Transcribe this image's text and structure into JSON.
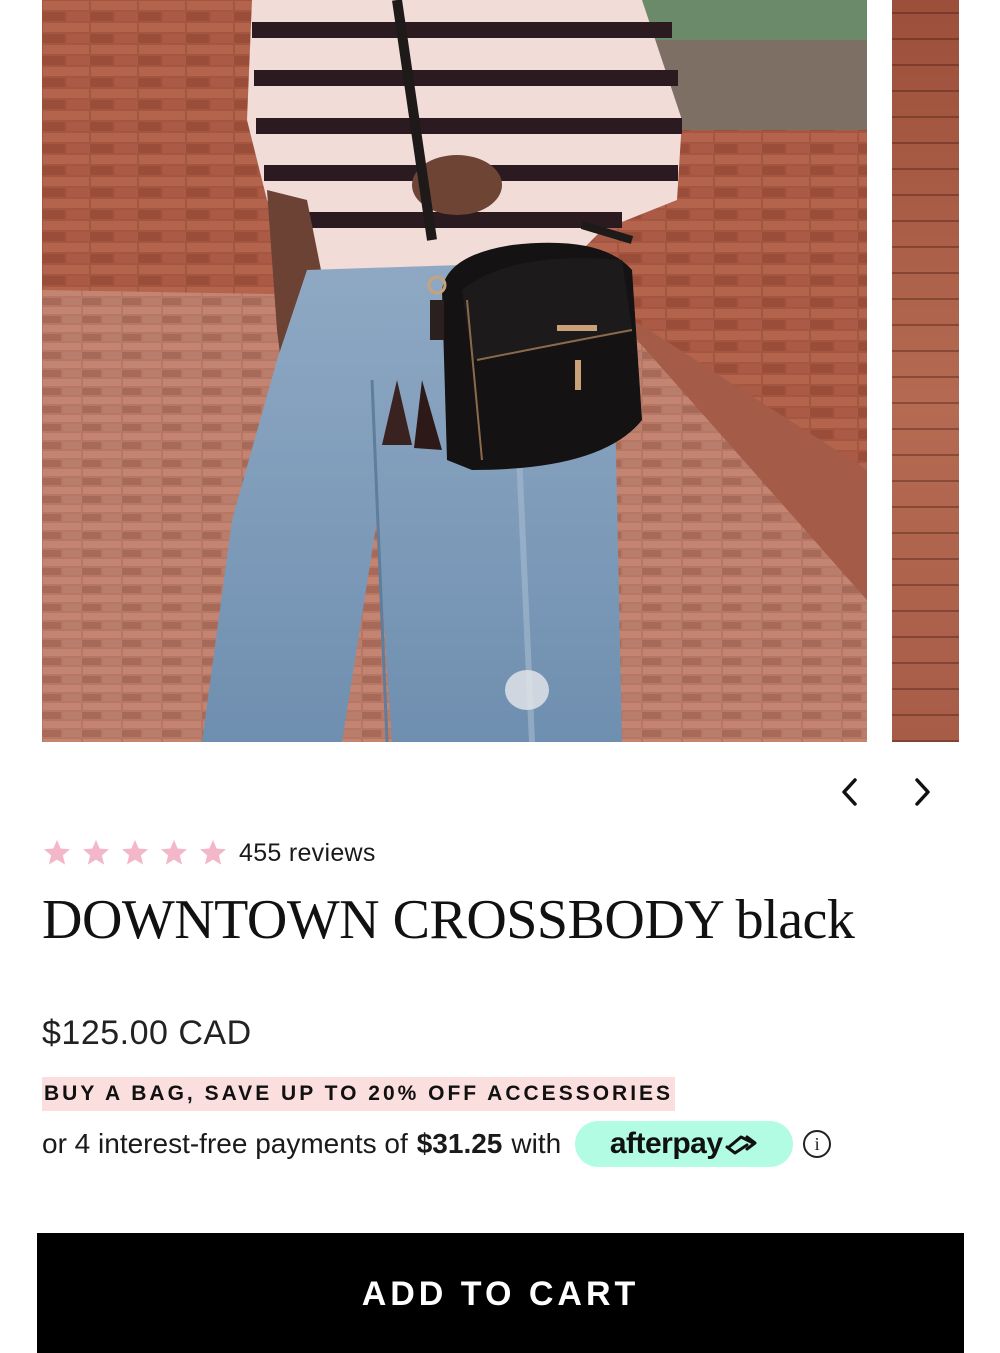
{
  "gallery": {
    "main_image_alt": "Woman wearing a striped sweater and wide-leg jeans carrying a black crossbody bag with tassels",
    "prev_icon": "chevron-left-icon",
    "next_icon": "chevron-right-icon"
  },
  "rating": {
    "stars": 5,
    "star_color": "#f4b6c9",
    "review_count": "455 reviews"
  },
  "product": {
    "title": "DOWNTOWN CROSSBODY black",
    "price": "$125.00 CAD"
  },
  "promo": {
    "text": "BUY A BAG, SAVE UP TO 20% OFF ACCESSORIES",
    "highlight_color": "#fbdede"
  },
  "payment": {
    "prefix": "or 4 interest-free payments of",
    "amount": "$31.25",
    "suffix": "with",
    "provider": "afterpay",
    "provider_color": "#b2fce4",
    "info_icon": "info-icon"
  },
  "cart": {
    "button_label": "ADD TO CART"
  }
}
